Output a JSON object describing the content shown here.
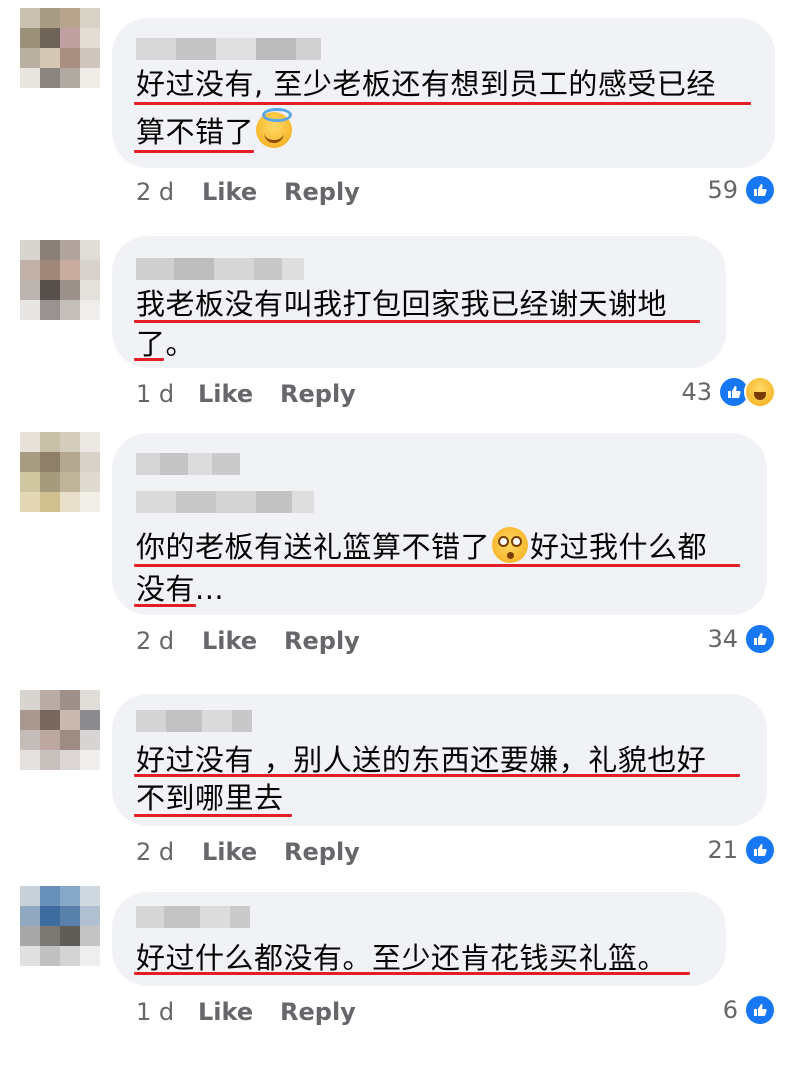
{
  "comments": [
    {
      "line1": "好过没有, 至少老板还有想到员工的感受已经",
      "line2": "算不错了",
      "emoji": "halo-emoji",
      "time": "2 d",
      "like": "Like",
      "reply": "Reply",
      "count": "59",
      "reactions": [
        "like-reaction"
      ]
    },
    {
      "line1": "我老板没有叫我打包回家我已经谢天谢地",
      "line2": "了。",
      "time": "1 d",
      "like": "Like",
      "reply": "Reply",
      "count": "43",
      "reactions": [
        "like-reaction",
        "haha-reaction"
      ]
    },
    {
      "line1a": "你的老板有送礼篮算不错了",
      "line1b": "好过我什么都",
      "emoji": "flushed-emoji",
      "line2": "没有...",
      "time": "2 d",
      "like": "Like",
      "reply": "Reply",
      "count": "34",
      "reactions": [
        "like-reaction"
      ]
    },
    {
      "line1": "好过没有 ，别人送的东西还要嫌，礼貌也好",
      "line2": "不到哪里去",
      "time": "2 d",
      "like": "Like",
      "reply": "Reply",
      "count": "21",
      "reactions": [
        "like-reaction"
      ]
    },
    {
      "line1": "好过什么都没有。至少还肯花钱买礼篮。",
      "time": "1 d",
      "like": "Like",
      "reply": "Reply",
      "count": "6",
      "reactions": [
        "like-reaction"
      ]
    }
  ],
  "colors": {
    "bubble": "#f0f2f5",
    "underline": "#e41e26",
    "meta": "#65676b",
    "like_blue": "#1877f2"
  }
}
